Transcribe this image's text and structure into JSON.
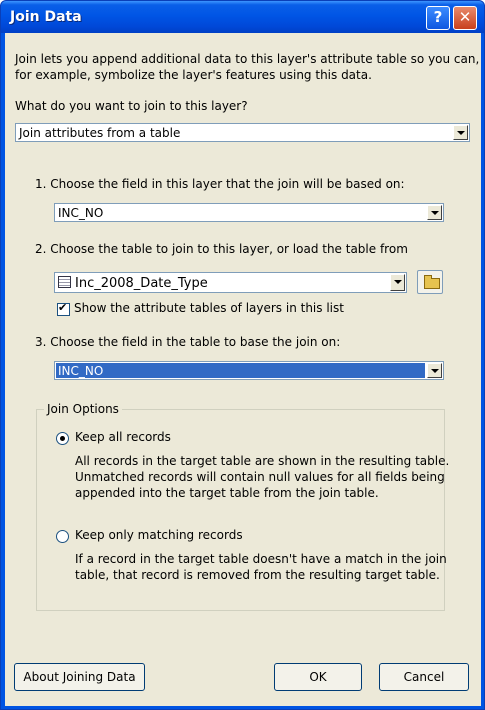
{
  "window": {
    "title": "Join Data",
    "help_label": "?",
    "close_label": "✕"
  },
  "intro": {
    "line1": "Join lets you append additional data to this layer's attribute table so you can,",
    "line2": "for example, symbolize the layer's features using this data."
  },
  "join_type": {
    "prompt_label": "What do you want to join to this layer?",
    "selected": "Join attributes from a table"
  },
  "step1": {
    "label": "1.  Choose the field in this layer that the join will be based on:",
    "selected": "INC_NO"
  },
  "step2": {
    "label": "2.  Choose the table to join to this layer, or load the table from",
    "selected": "Inc_2008_Date_Type",
    "show_tables_label": "Show the attribute tables of layers in this list",
    "show_tables_checked": true
  },
  "step3": {
    "label": "3.  Choose the field in the table to base the join on:",
    "selected": "INC_NO"
  },
  "join_options": {
    "legend": "Join Options",
    "keep_all_label": "Keep all records",
    "keep_all_selected": true,
    "keep_all_desc": [
      "All records in the target table are shown in the resulting table.",
      "Unmatched records will contain null values for all fields being",
      "appended into the target table from the join table."
    ],
    "keep_matching_label": "Keep only matching records",
    "keep_matching_desc": [
      "If a record in the target table doesn't have a match in the join",
      "table, that record is removed from the resulting target table."
    ]
  },
  "buttons": {
    "about": "About Joining Data",
    "ok": "OK",
    "cancel": "Cancel"
  }
}
